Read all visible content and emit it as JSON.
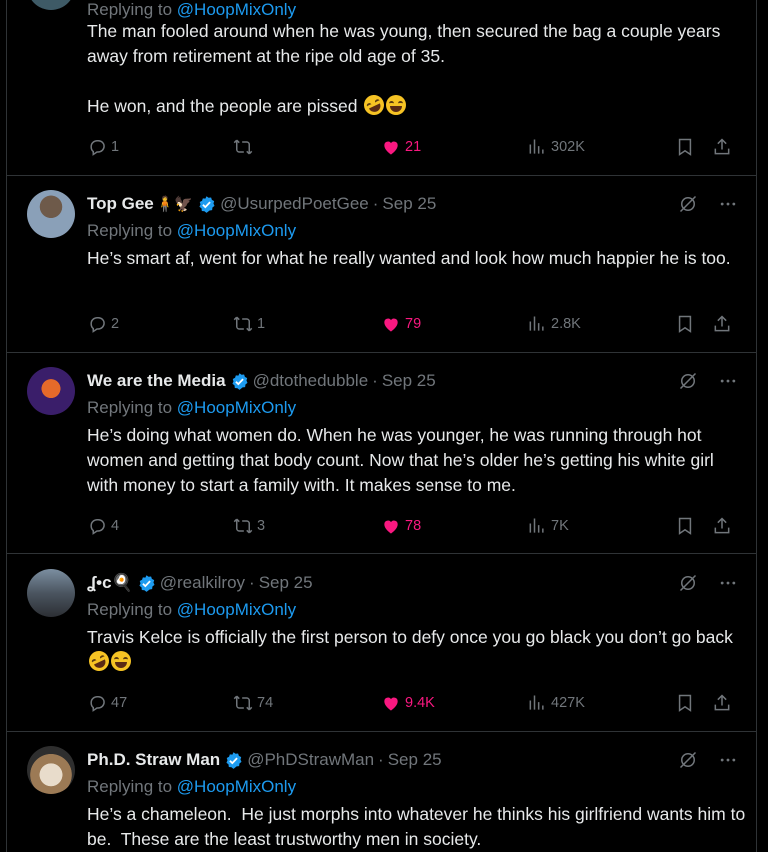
{
  "top_post": {
    "replying_label": "Replying to",
    "replying_to": "@HoopMixOnly",
    "paragraphs": [
      "The man fooled around when he was young, then secured the bag a couple years away from retirement at the ripe old age of 35.",
      "He won, and the people are pissed"
    ],
    "actions": {
      "replies": "1",
      "reposts": "",
      "likes": "21",
      "views": "302K"
    }
  },
  "posts": [
    {
      "name": "Top Gee",
      "name_emoji": "🧍🦅",
      "handle": "@UsurpedPoetGee",
      "date": "Sep 25",
      "replying_label": "Replying to",
      "replying_to": "@HoopMixOnly",
      "text": "He’s smart af, went for what he really wanted and look how much happier he is too.",
      "actions": {
        "replies": "2",
        "reposts": "1",
        "likes": "79",
        "views": "2.8K"
      }
    },
    {
      "name": "We are the Media",
      "handle": "@dtothedubble",
      "date": "Sep 25",
      "replying_label": "Replying to",
      "replying_to": "@HoopMixOnly",
      "text": "He’s doing what women do. When he was younger, he was running through hot women and getting that body count. Now that he’s older he’s getting his white girl with money to start a family with. It makes sense to me.",
      "actions": {
        "replies": "4",
        "reposts": "3",
        "likes": "78",
        "views": "7K"
      }
    },
    {
      "name": "ʆ•c🍳",
      "handle": "@realkilroy",
      "date": "Sep 25",
      "replying_label": "Replying to",
      "replying_to": "@HoopMixOnly",
      "text": "Travis Kelce is officially the first person to defy once you go black you don’t go back",
      "actions": {
        "replies": "47",
        "reposts": "74",
        "likes": "9.4K",
        "views": "427K"
      }
    },
    {
      "name": "Ph.D. Straw Man",
      "handle": "@PhDStrawMan",
      "date": "Sep 25",
      "replying_label": "Replying to",
      "replying_to": "@HoopMixOnly",
      "text": "He’s a chameleon.  He just morphs into whatever he thinks his girlfriend wants him to be.  These are the least trustworthy men in society."
    }
  ],
  "colors": {
    "accent": "#1d9bf0",
    "like": "#f91880",
    "muted": "#71767b",
    "text": "#e7e9ea",
    "bg": "#000000",
    "border": "#2f3336"
  },
  "icons": [
    "reply-icon",
    "repost-icon",
    "like-icon",
    "views-icon",
    "bookmark-icon",
    "share-icon",
    "grok-icon",
    "more-icon",
    "verified-badge-icon"
  ]
}
